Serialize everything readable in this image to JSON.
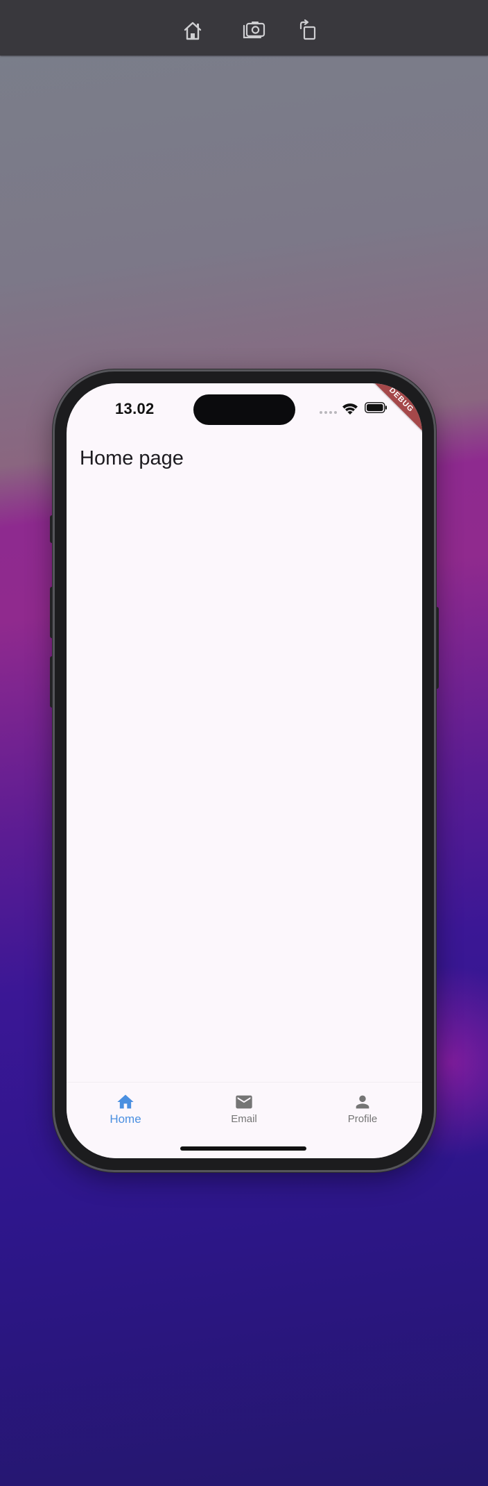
{
  "toolbar": {
    "icons": [
      "home-icon",
      "screenshot-icon",
      "rotate-icon"
    ]
  },
  "status_bar": {
    "time": "13.02",
    "icons": [
      "signal-icon",
      "wifi-icon",
      "battery-icon"
    ]
  },
  "debug_banner": "DEBUG",
  "page": {
    "title": "Home page"
  },
  "bottom_nav": {
    "selected": "Home",
    "items": [
      {
        "label": "Home",
        "icon": "home-icon"
      },
      {
        "label": "Email",
        "icon": "email-icon"
      },
      {
        "label": "Profile",
        "icon": "profile-icon"
      }
    ]
  },
  "colors": {
    "accent": "#4a8fe0",
    "inactive": "#757575",
    "screen_background": "#fcf7fc",
    "debug_ribbon": "#a5484a",
    "toolbar": "#39383d"
  }
}
